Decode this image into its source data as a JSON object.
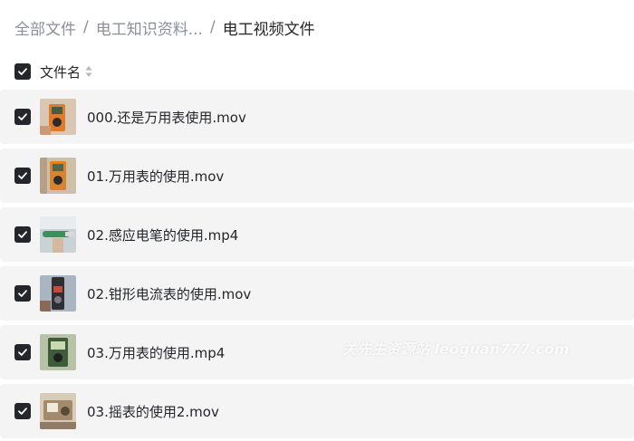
{
  "breadcrumb": {
    "items": [
      "全部文件",
      "电工知识资料...",
      "电工视频文件"
    ],
    "separator": "/"
  },
  "header": {
    "select_all_checked": true,
    "column_label": "文件名",
    "sort_icon": "sort-updown-icon"
  },
  "files": [
    {
      "name": "000.还是万用表使用.mov",
      "checked": true,
      "thumb_icon": "video-thumbnail"
    },
    {
      "name": "01.万用表的使用.mov",
      "checked": true,
      "thumb_icon": "video-thumbnail"
    },
    {
      "name": "02.感应电笔的使用.mp4",
      "checked": true,
      "thumb_icon": "video-thumbnail"
    },
    {
      "name": "02.钳形电流表的使用.mov",
      "checked": true,
      "thumb_icon": "video-thumbnail"
    },
    {
      "name": "03.万用表的使用.mp4",
      "checked": true,
      "thumb_icon": "video-thumbnail"
    },
    {
      "name": "03.摇表的使用2.mov",
      "checked": true,
      "thumb_icon": "video-thumbnail"
    }
  ],
  "watermark": "关先生资源站 leoguan777.com",
  "colors": {
    "row_background": "#f4f4f5",
    "checkbox": "#25262b",
    "muted_text": "#8a8f99"
  }
}
